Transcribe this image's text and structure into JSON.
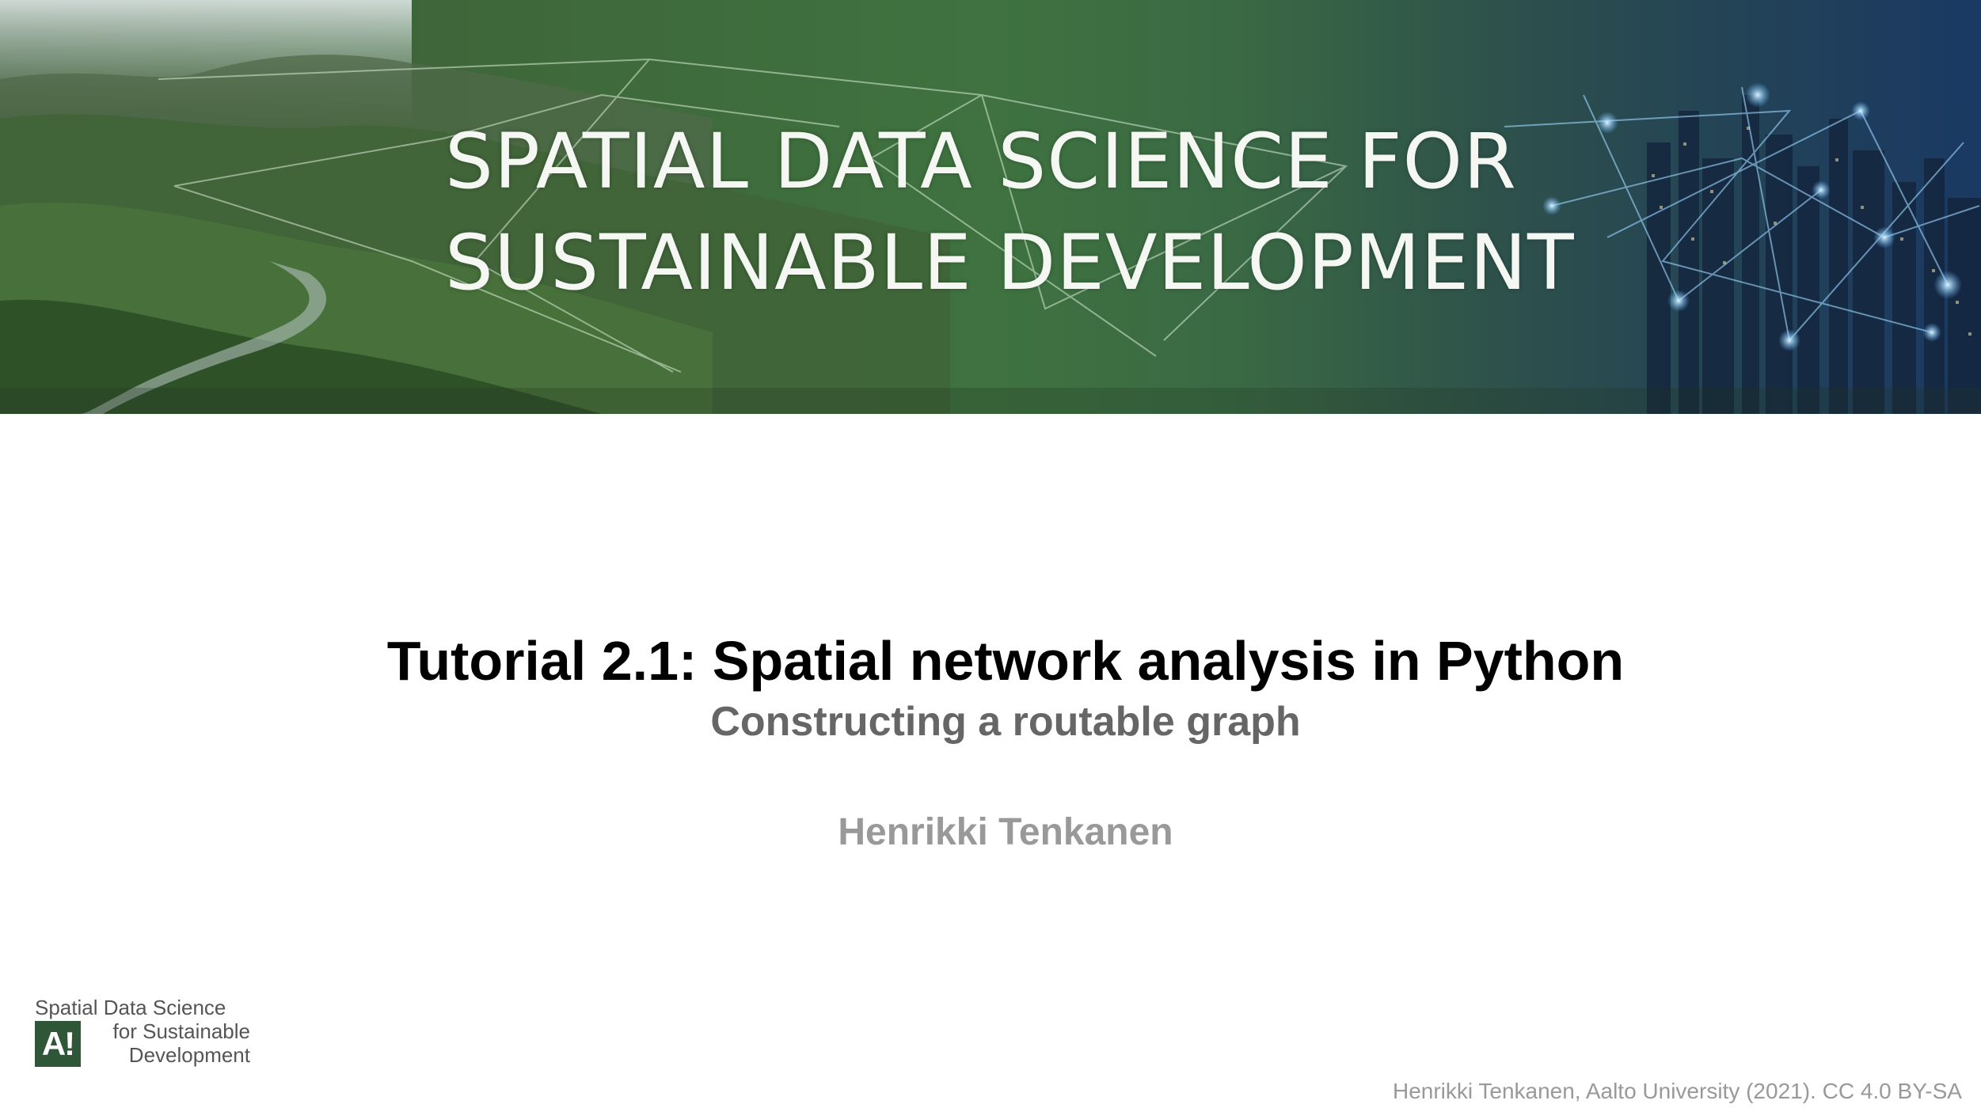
{
  "banner": {
    "title_line1": "SPATIAL DATA SCIENCE FOR",
    "title_line2": "SUSTAINABLE DEVELOPMENT"
  },
  "title": {
    "main": "Tutorial 2.1: Spatial network analysis in Python",
    "subtitle": "Constructing a routable graph",
    "author": "Henrikki Tenkanen"
  },
  "logo": {
    "line1": "Spatial Data Science",
    "mark": "A!",
    "line2": "for Sustainable",
    "line3": "Development"
  },
  "footer": {
    "credit": "Henrikki Tenkanen, Aalto University (2021). CC 4.0 BY-SA"
  },
  "colors": {
    "title": "#000000",
    "subtitle": "#666666",
    "author": "#999999",
    "logo_green": "#2f5637"
  }
}
